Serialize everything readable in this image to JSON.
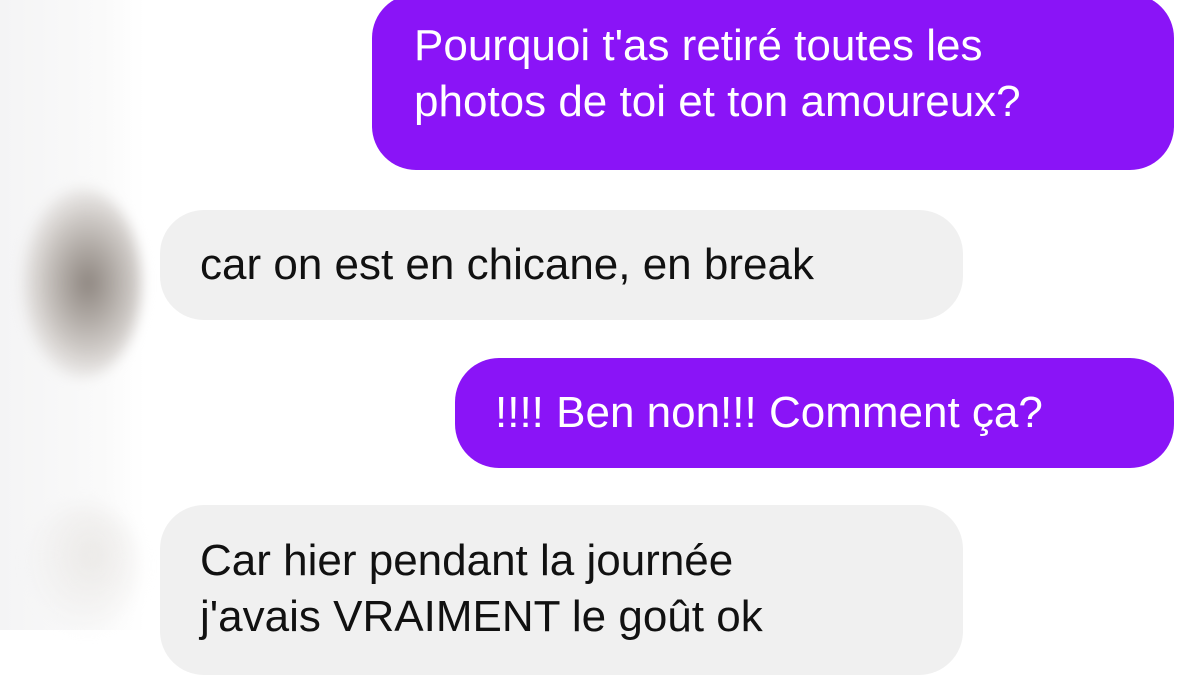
{
  "conversation": {
    "messages": [
      {
        "direction": "sent",
        "lines": [
          "Pourquoi t'as retiré toutes les",
          "photos de toi et ton amoureux?"
        ]
      },
      {
        "direction": "received",
        "lines": [
          "car on est en chicane, en break"
        ]
      },
      {
        "direction": "sent",
        "lines": [
          "!!!! Ben non!!! Comment ça?"
        ]
      },
      {
        "direction": "received",
        "lines": [
          "Car hier pendant la journée",
          "j'avais VRAIMENT le goût ok"
        ]
      }
    ]
  },
  "colors": {
    "sent_bubble": "#8a14f7",
    "sent_text": "#ffffff",
    "received_bubble": "#f0f0f0",
    "received_text": "#111111"
  },
  "icons": {
    "contact_avatar": "blurred-avatar-icon"
  }
}
